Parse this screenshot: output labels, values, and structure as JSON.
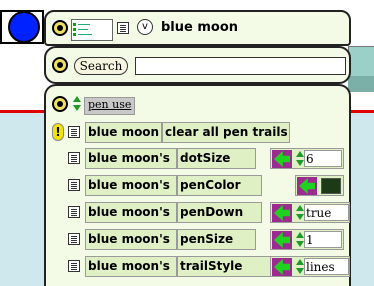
{
  "viewer": {
    "object_name": "blue moon",
    "title_menu_glyph": "v",
    "search": {
      "button_label": "Search",
      "value": ""
    },
    "category": {
      "name": "pen use"
    },
    "command": {
      "object": "blue moon",
      "action": "clear all pen trails"
    },
    "properties": [
      {
        "owner": "blue moon's",
        "name": "dotSize",
        "value": "6"
      },
      {
        "owner": "blue moon's",
        "name": "penColor",
        "value": ""
      },
      {
        "owner": "blue moon's",
        "name": "penDown",
        "value": "true"
      },
      {
        "owner": "blue moon's",
        "name": "penSize",
        "value": "1"
      },
      {
        "owner": "blue moon's",
        "name": "trailStyle",
        "value": "lines"
      }
    ]
  },
  "colors": {
    "panel_bg": "#f3fbe6",
    "tile_bg": "#dff0c4",
    "pen_color": "#1d3a17",
    "arrow_green": "#1fd21f",
    "purple": "#9b2b8f",
    "object_blue": "#0022ff"
  },
  "icons": {
    "orb": "menu-orb-icon",
    "thumbnail": "object-thumbnail-icon",
    "tile": "tile-icon",
    "assign": "assignment-arrow-icon",
    "bang": "exclamation-icon"
  }
}
